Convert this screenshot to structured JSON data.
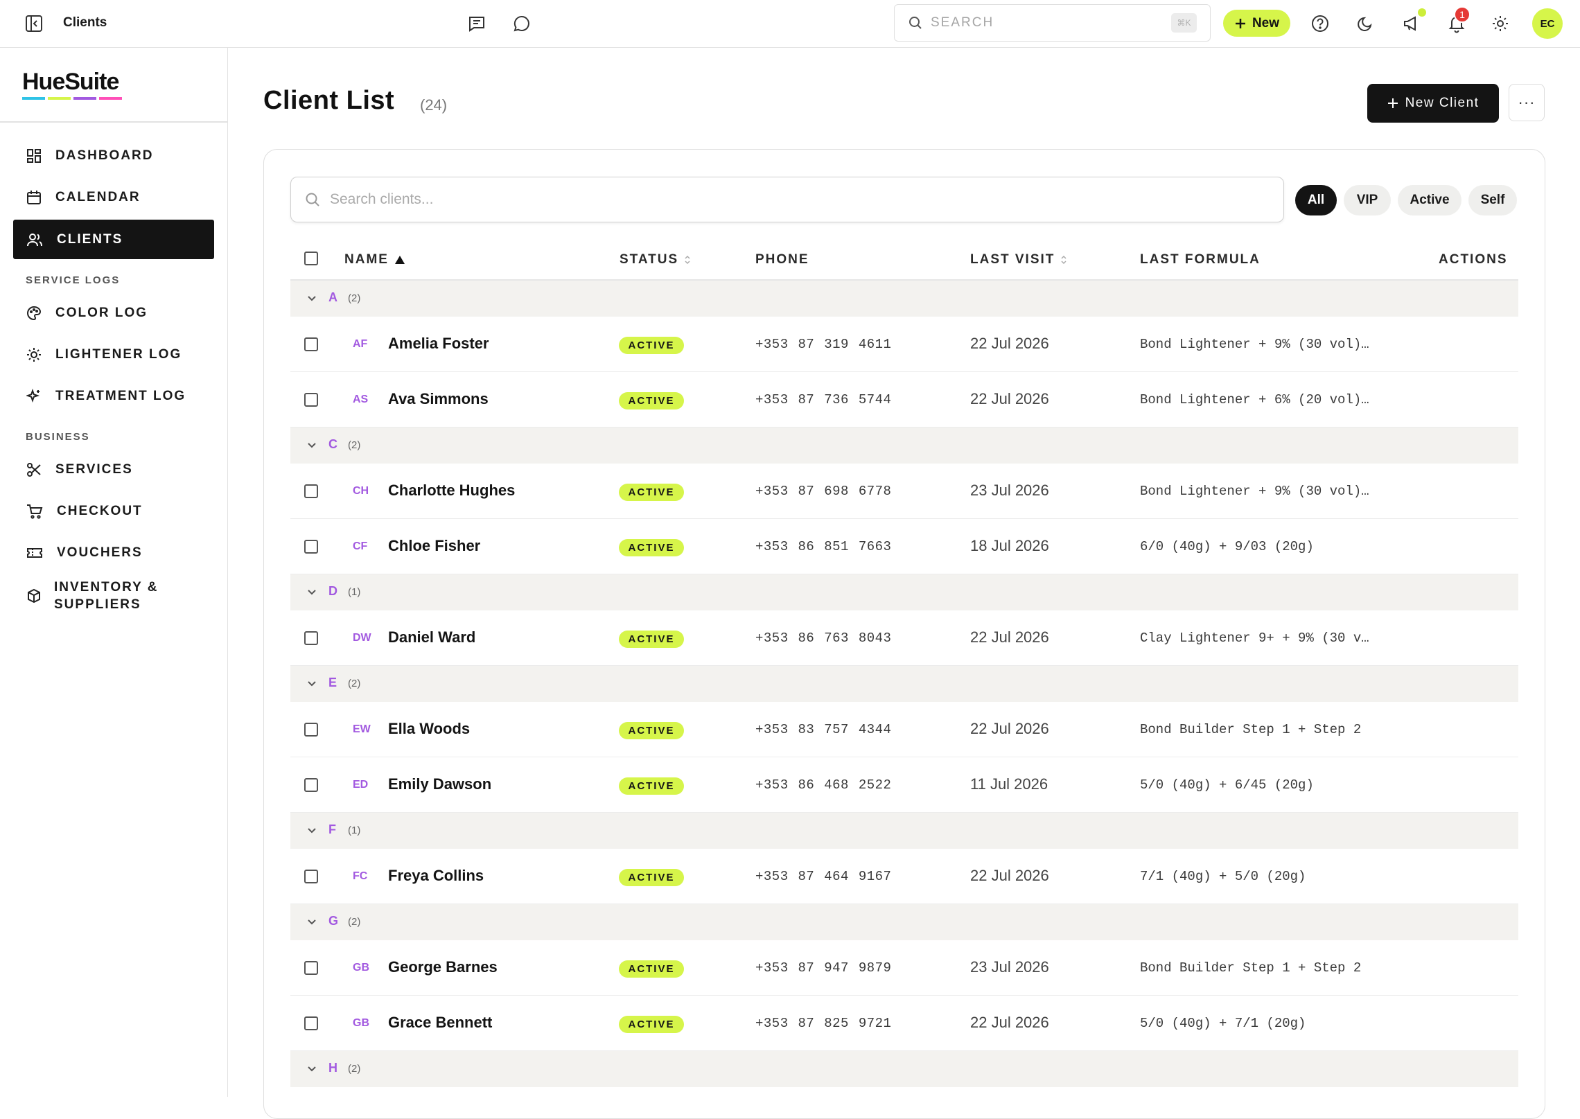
{
  "topbar": {
    "title": "Clients",
    "search_placeholder": "SEARCH",
    "search_shortcut": "⌘K",
    "new_label": "New",
    "notification_count": "1",
    "user_initials": "EC"
  },
  "sidebar": {
    "logo": "HueSuite",
    "logo_colors": [
      "#2fc3e6",
      "#d6f54a",
      "#a259e0",
      "#ff4fb8"
    ],
    "items": [
      {
        "label": "DASHBOARD",
        "icon": "dashboard-icon"
      },
      {
        "label": "CALENDAR",
        "icon": "calendar-icon"
      },
      {
        "label": "CLIENTS",
        "icon": "users-icon",
        "active": true
      }
    ],
    "section_service": "SERVICE LOGS",
    "service_items": [
      {
        "label": "COLOR LOG",
        "icon": "palette-icon"
      },
      {
        "label": "LIGHTENER LOG",
        "icon": "sun-icon"
      },
      {
        "label": "TREATMENT LOG",
        "icon": "sparkle-icon"
      }
    ],
    "section_business": "BUSINESS",
    "business_items": [
      {
        "label": "SERVICES",
        "icon": "scissors-icon"
      },
      {
        "label": "CHECKOUT",
        "icon": "cart-icon"
      },
      {
        "label": "VOUCHERS",
        "icon": "ticket-icon"
      },
      {
        "label": "INVENTORY & SUPPLIERS",
        "icon": "box-icon"
      }
    ]
  },
  "main": {
    "title": "Client List",
    "count": "(24)",
    "new_client_label": "New Client",
    "more_label": "···",
    "search_placeholder": "Search clients...",
    "filters": [
      "All",
      "VIP",
      "Active",
      "Self"
    ],
    "selected_filter": "All",
    "columns": {
      "name": "NAME",
      "status": "STATUS",
      "phone": "PHONE",
      "last_visit": "LAST VISIT",
      "last_formula": "LAST FORMULA",
      "actions": "ACTIONS"
    }
  },
  "groups": [
    {
      "letter": "A",
      "count": "(2)",
      "clients": [
        {
          "initials": "AF",
          "name": "Amelia Foster",
          "status": "ACTIVE",
          "phone": "+353 87 319 4611",
          "last_visit": "22 Jul 2026",
          "formula": "Bond Lightener + 9% (30 vol)…"
        },
        {
          "initials": "AS",
          "name": "Ava Simmons",
          "status": "ACTIVE",
          "phone": "+353 87 736 5744",
          "last_visit": "22 Jul 2026",
          "formula": "Bond Lightener + 6% (20 vol)…"
        }
      ]
    },
    {
      "letter": "C",
      "count": "(2)",
      "clients": [
        {
          "initials": "CH",
          "name": "Charlotte Hughes",
          "status": "ACTIVE",
          "phone": "+353 87 698 6778",
          "last_visit": "23 Jul 2026",
          "formula": "Bond Lightener + 9% (30 vol)…"
        },
        {
          "initials": "CF",
          "name": "Chloe Fisher",
          "status": "ACTIVE",
          "phone": "+353 86 851 7663",
          "last_visit": "18 Jul 2026",
          "formula": "6/0 (40g) + 9/03 (20g)"
        }
      ]
    },
    {
      "letter": "D",
      "count": "(1)",
      "clients": [
        {
          "initials": "DW",
          "name": "Daniel Ward",
          "status": "ACTIVE",
          "phone": "+353 86 763 8043",
          "last_visit": "22 Jul 2026",
          "formula": "Clay Lightener 9+ + 9% (30 v…"
        }
      ]
    },
    {
      "letter": "E",
      "count": "(2)",
      "clients": [
        {
          "initials": "EW",
          "name": "Ella Woods",
          "status": "ACTIVE",
          "phone": "+353 83 757 4344",
          "last_visit": "22 Jul 2026",
          "formula": "Bond Builder Step 1 + Step 2"
        },
        {
          "initials": "ED",
          "name": "Emily Dawson",
          "status": "ACTIVE",
          "phone": "+353 86 468 2522",
          "last_visit": "11 Jul 2026",
          "formula": "5/0 (40g) + 6/45 (20g)"
        }
      ]
    },
    {
      "letter": "F",
      "count": "(1)",
      "clients": [
        {
          "initials": "FC",
          "name": "Freya Collins",
          "status": "ACTIVE",
          "phone": "+353 87 464 9167",
          "last_visit": "22 Jul 2026",
          "formula": "7/1 (40g) + 5/0 (20g)"
        }
      ]
    },
    {
      "letter": "G",
      "count": "(2)",
      "clients": [
        {
          "initials": "GB",
          "name": "George Barnes",
          "status": "ACTIVE",
          "phone": "+353 87 947 9879",
          "last_visit": "23 Jul 2026",
          "formula": "Bond Builder Step 1 + Step 2"
        },
        {
          "initials": "GB",
          "name": "Grace Bennett",
          "status": "ACTIVE",
          "phone": "+353 87 825 9721",
          "last_visit": "22 Jul 2026",
          "formula": "5/0 (40g) + 7/1 (20g)"
        }
      ]
    },
    {
      "letter": "H",
      "count": "(2)",
      "clients": []
    }
  ]
}
